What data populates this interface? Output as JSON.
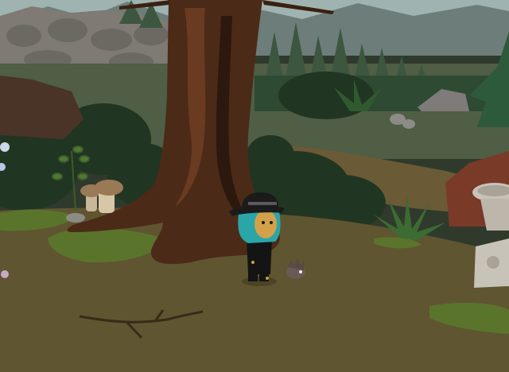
{
  "scene": {
    "name": "forest-clearing",
    "palette": {
      "sky": "#9fb4b0",
      "mountain": "#6d7d7a",
      "rock": "#7f7a73",
      "rock_dark": "#5e5a55",
      "far_grass": "#4f5e44",
      "dark_foliage": "#213523",
      "mid_foliage": "#2f4a32",
      "path": "#6b5a36",
      "ground": "#5f5530",
      "moss": "#5a7a2c",
      "trunk": "#4b2a18",
      "trunk_light": "#6a3b20",
      "trunk_dark": "#2d180d",
      "mushroom": "#c9b79a",
      "mushroom_cap": "#9a7a56",
      "birdbath": "#c8c3b8",
      "red_rock": "#7a3a28"
    }
  },
  "avatar": {
    "hair_color": "#2aa6a8",
    "skin_color": "#d2a14a",
    "hat_color": "#1b1b1b",
    "outfit_color": "#141414",
    "accent_color": "#c9a23a"
  },
  "pet": {
    "icon": "small-hedgehog-pet",
    "color": "#6a5a55"
  }
}
